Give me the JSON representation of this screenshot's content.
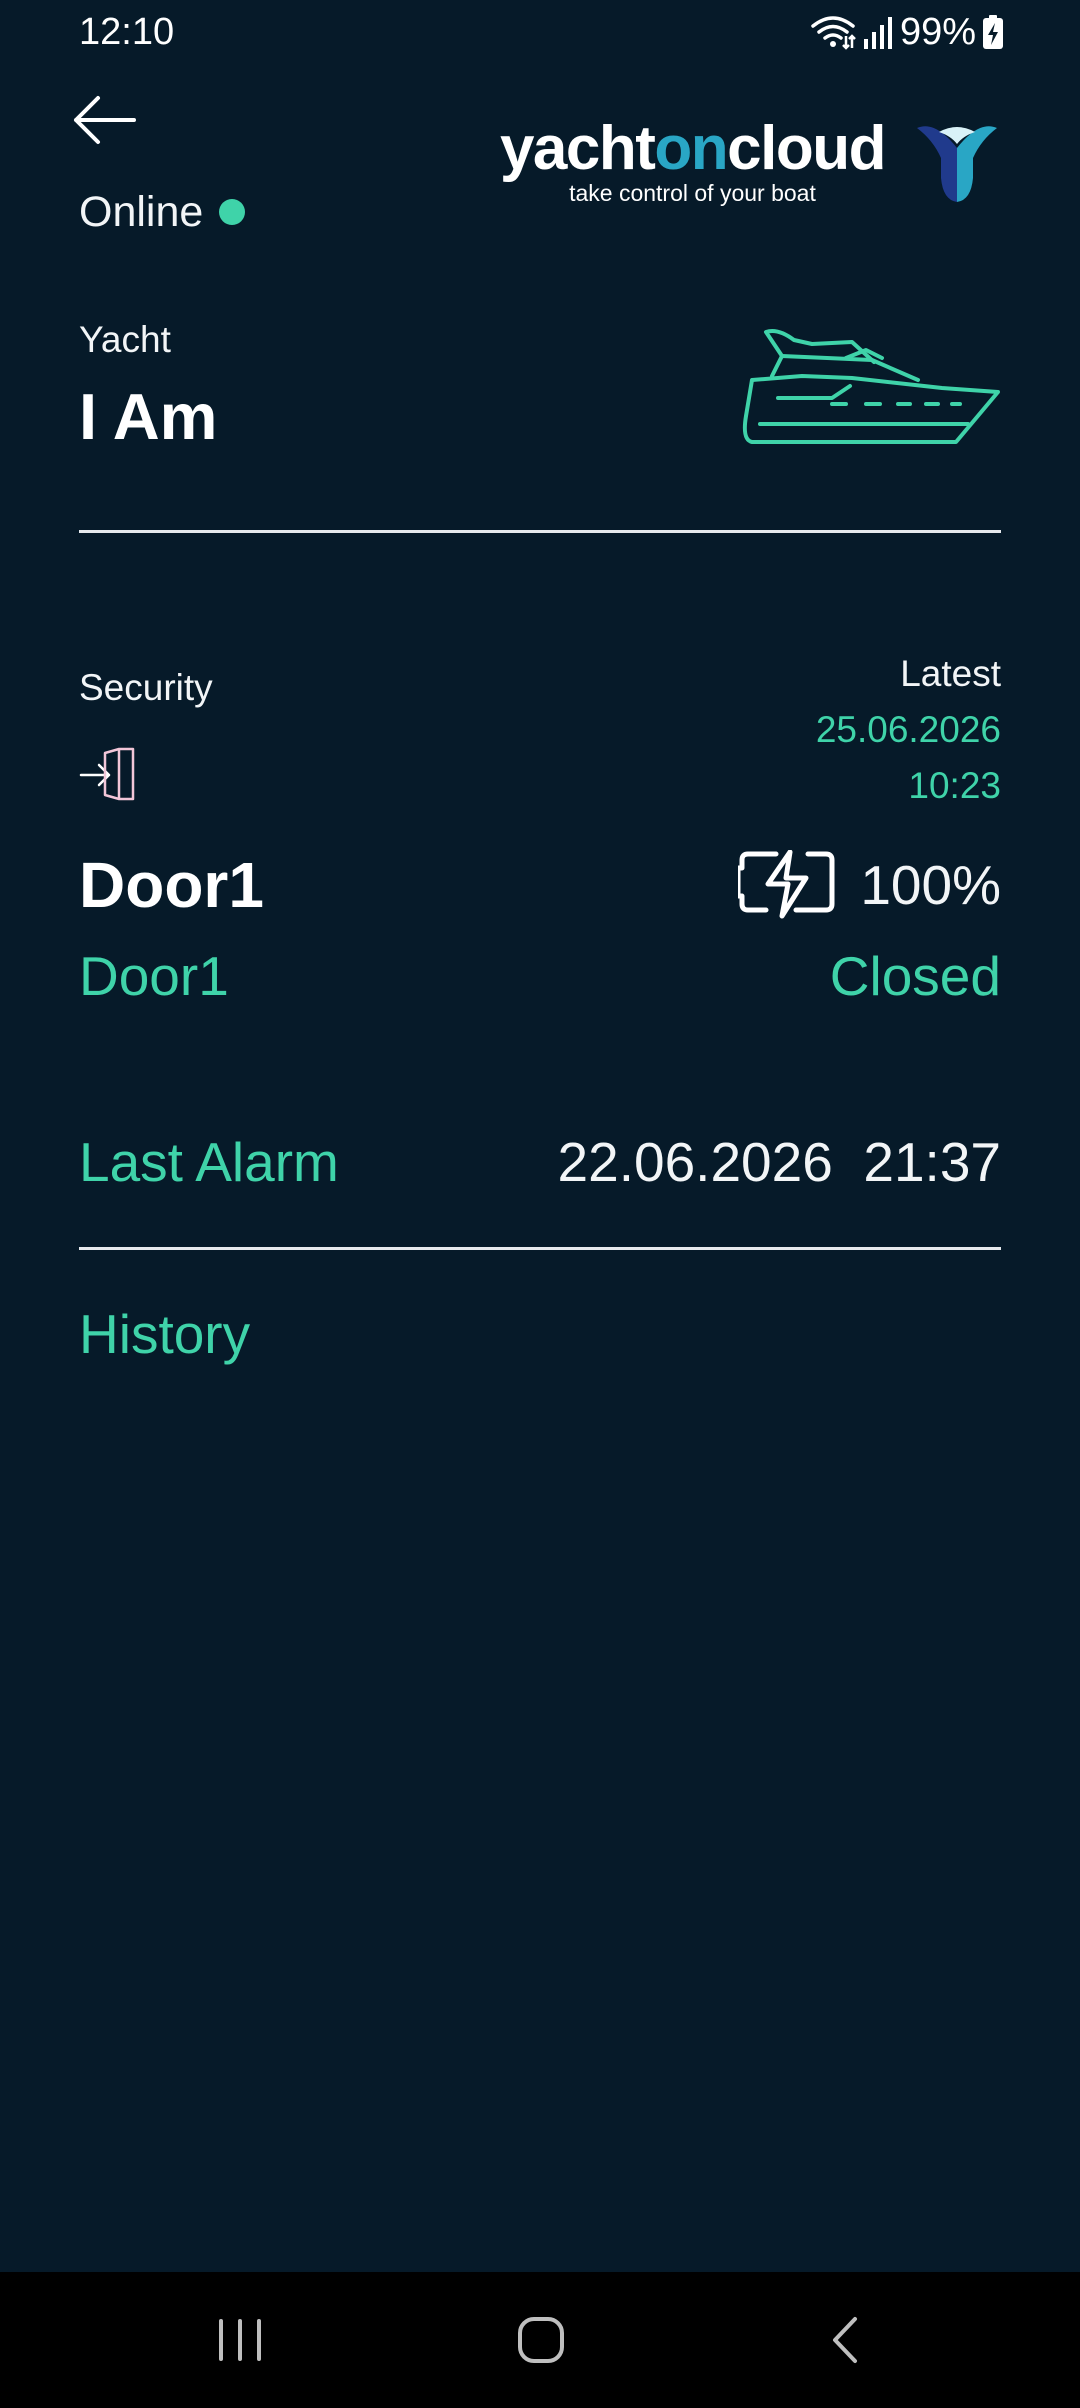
{
  "status_bar": {
    "time": "12:10",
    "battery": "99%",
    "icons": [
      "wifi-icon",
      "signal-icon",
      "battery-charging-icon"
    ]
  },
  "header": {
    "back_icon": "arrow-left-icon",
    "connection_status": "Online",
    "connection_color": "#3fd3a9",
    "logo": {
      "word_part1": "yacht",
      "word_part2": "on",
      "word_part3": "cloud",
      "tagline": "take control of your boat"
    }
  },
  "yacht": {
    "label": "Yacht",
    "name": "I Am",
    "icon": "yacht-icon"
  },
  "sensor": {
    "category": "Security",
    "category_icon": "door-enter-icon",
    "latest_label": "Latest",
    "latest_date": "25.06.2026",
    "latest_time": "10:23",
    "name": "Door1",
    "subtitle": "Door1",
    "battery_icon": "battery-bolt-icon",
    "battery_level": "100%",
    "state": "Closed"
  },
  "alarm": {
    "label": "Last Alarm",
    "value": "22.06.2026  21:37"
  },
  "history": {
    "label": "History"
  },
  "colors": {
    "background": "#061a29",
    "accent": "#3fd3a9",
    "logo_blue": "#29a6c5"
  },
  "navbar": {
    "icons": [
      "recent-apps-icon",
      "home-icon",
      "back-icon"
    ]
  }
}
